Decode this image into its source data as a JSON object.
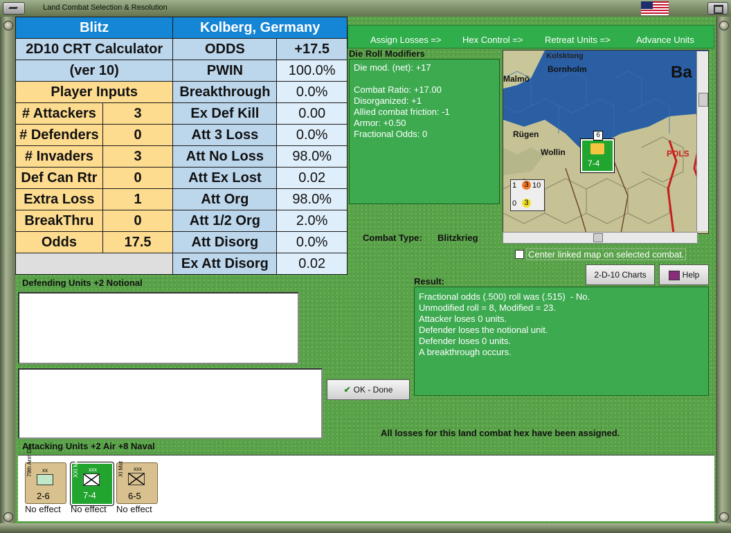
{
  "window": {
    "title": "Land Combat Selection & Resolution"
  },
  "crt": {
    "header_left": "Blitz",
    "header_right": "Kolberg, Germany",
    "calc_title": "2D10 CRT Calculator",
    "version": "(ver 10)",
    "player_inputs": "Player Inputs",
    "inputs": [
      {
        "label": "# Attackers",
        "value": "3"
      },
      {
        "label": "# Defenders",
        "value": "0"
      },
      {
        "label": "# Invaders",
        "value": "3"
      },
      {
        "label": "Def Can Rtr",
        "value": "0"
      },
      {
        "label": "Extra Loss",
        "value": "1"
      },
      {
        "label": "BreakThru",
        "value": "0"
      },
      {
        "label": "Odds",
        "value": "17.5"
      }
    ],
    "results": [
      {
        "label": "ODDS",
        "value": "+17.5"
      },
      {
        "label": "PWIN",
        "value": "100.0%"
      },
      {
        "label": "Breakthrough",
        "value": "0.0%"
      },
      {
        "label": "Ex Def Kill",
        "value": "0.00"
      },
      {
        "label": "Att 3 Loss",
        "value": "0.0%"
      },
      {
        "label": "Att No Loss",
        "value": "98.0%"
      },
      {
        "label": "Att Ex Lost",
        "value": "0.02"
      },
      {
        "label": "Att Org",
        "value": "98.0%"
      },
      {
        "label": "Att 1/2 Org",
        "value": "2.0%"
      },
      {
        "label": "Att Disorg",
        "value": "0.0%"
      },
      {
        "label": "Ex Att Disorg",
        "value": "0.02"
      }
    ]
  },
  "phases": [
    "Assign Losses =>",
    "Hex Control =>",
    "Retreat Units =>",
    "Advance Units"
  ],
  "die_roll": {
    "title": "Die Roll Modifiers",
    "lines": "Die mod. (net): +17\n\nCombat Ratio: +17.00\nDisorganized: +1\nAllied combat friction: -1\nArmor: +0.50\nFractional Odds: 0"
  },
  "combat_type": {
    "label": "Combat Type:",
    "value": "Blitzkrieg"
  },
  "map": {
    "labels": [
      "Malmö",
      "Bornholm",
      "Ba",
      "Rügen",
      "Wollin",
      "POLS",
      "Kolsktong"
    ],
    "unit_strength": "7-4",
    "stack_top": [
      "1",
      "3",
      "10"
    ],
    "stack_bottom": [
      "0",
      "3"
    ],
    "unit_count": "6"
  },
  "center_map": {
    "label": "Center linked map on selected combat."
  },
  "buttons": {
    "charts": "2-D-10 Charts",
    "help": "Help",
    "ok": "OK - Done"
  },
  "result": {
    "title": "Result:",
    "lines": "Fractional odds (.500) roll was (.515)  - No.\nUnmodified roll = 8, Modified = 23.\nAttacker loses 0 units.\nDefender loses the notional unit.\nDefender loses 0 units.\nA breakthrough occurs."
  },
  "defending": {
    "title": "Defending Units +2 Notional"
  },
  "status_message": "All losses for this land combat hex have been assigned.",
  "attacking": {
    "title": "Attacking Units +2 Air +8 Naval",
    "units": [
      {
        "side": "79th Arm Div",
        "size": "xx",
        "strength": "2-6",
        "status": "No effect",
        "color": "#d8c18f"
      },
      {
        "side": "XXI Mot",
        "size": "xxx",
        "strength": "7-4",
        "status": "No effect",
        "color": "#22a52f"
      },
      {
        "side": "XI Mot",
        "size": "xxx",
        "strength": "6-5",
        "status": "No effect",
        "color": "#d8c18f"
      }
    ]
  }
}
